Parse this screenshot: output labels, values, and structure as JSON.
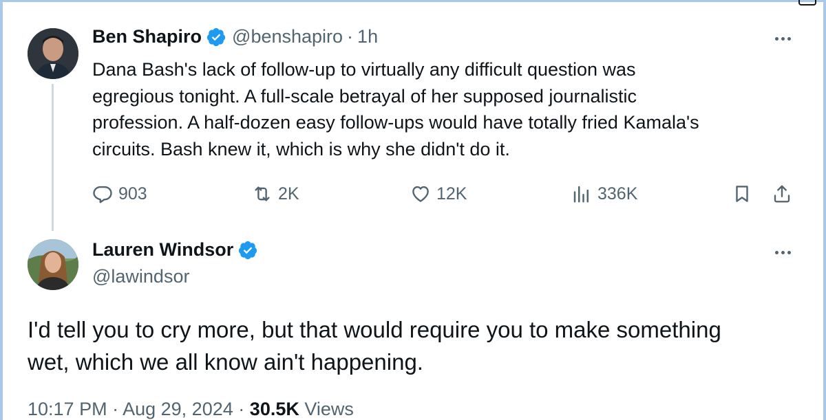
{
  "tweet_1": {
    "display_name": "Ben Shapiro",
    "handle": "@benshapiro",
    "separator": "·",
    "time": "1h",
    "text_lines": [
      "Dana Bash's lack of follow-up to virtually any difficult question was",
      "egregious tonight. A full-scale betrayal of her supposed journalistic",
      "profession. A half-dozen easy follow-ups would have totally fried Kamala's",
      "circuits. Bash knew it, which is why she didn't do it."
    ],
    "actions": {
      "replies": "903",
      "reposts": "2K",
      "likes": "12K",
      "views": "336K"
    },
    "icons": [
      "verified-badge-icon",
      "more-icon",
      "reply-icon",
      "retweet-icon",
      "like-icon",
      "views-icon",
      "bookmark-icon",
      "share-icon"
    ]
  },
  "tweet_2": {
    "display_name": "Lauren Windsor",
    "handle": "@lawindsor",
    "text_lines": [
      "I'd tell you to cry more, but that would require you to make something",
      "wet, which we all know ain't happening."
    ],
    "meta": {
      "time": "10:17 PM",
      "sep1": "·",
      "date": "Aug 29, 2024",
      "sep2": "·",
      "views_count": "30.5K",
      "views_label": "Views"
    }
  },
  "colors": {
    "verified_blue": "#1d9bf0",
    "text_primary": "#0f1419",
    "text_secondary": "#536471",
    "thread_line": "#cfd9de",
    "frame_border": "#a9c9e8"
  }
}
